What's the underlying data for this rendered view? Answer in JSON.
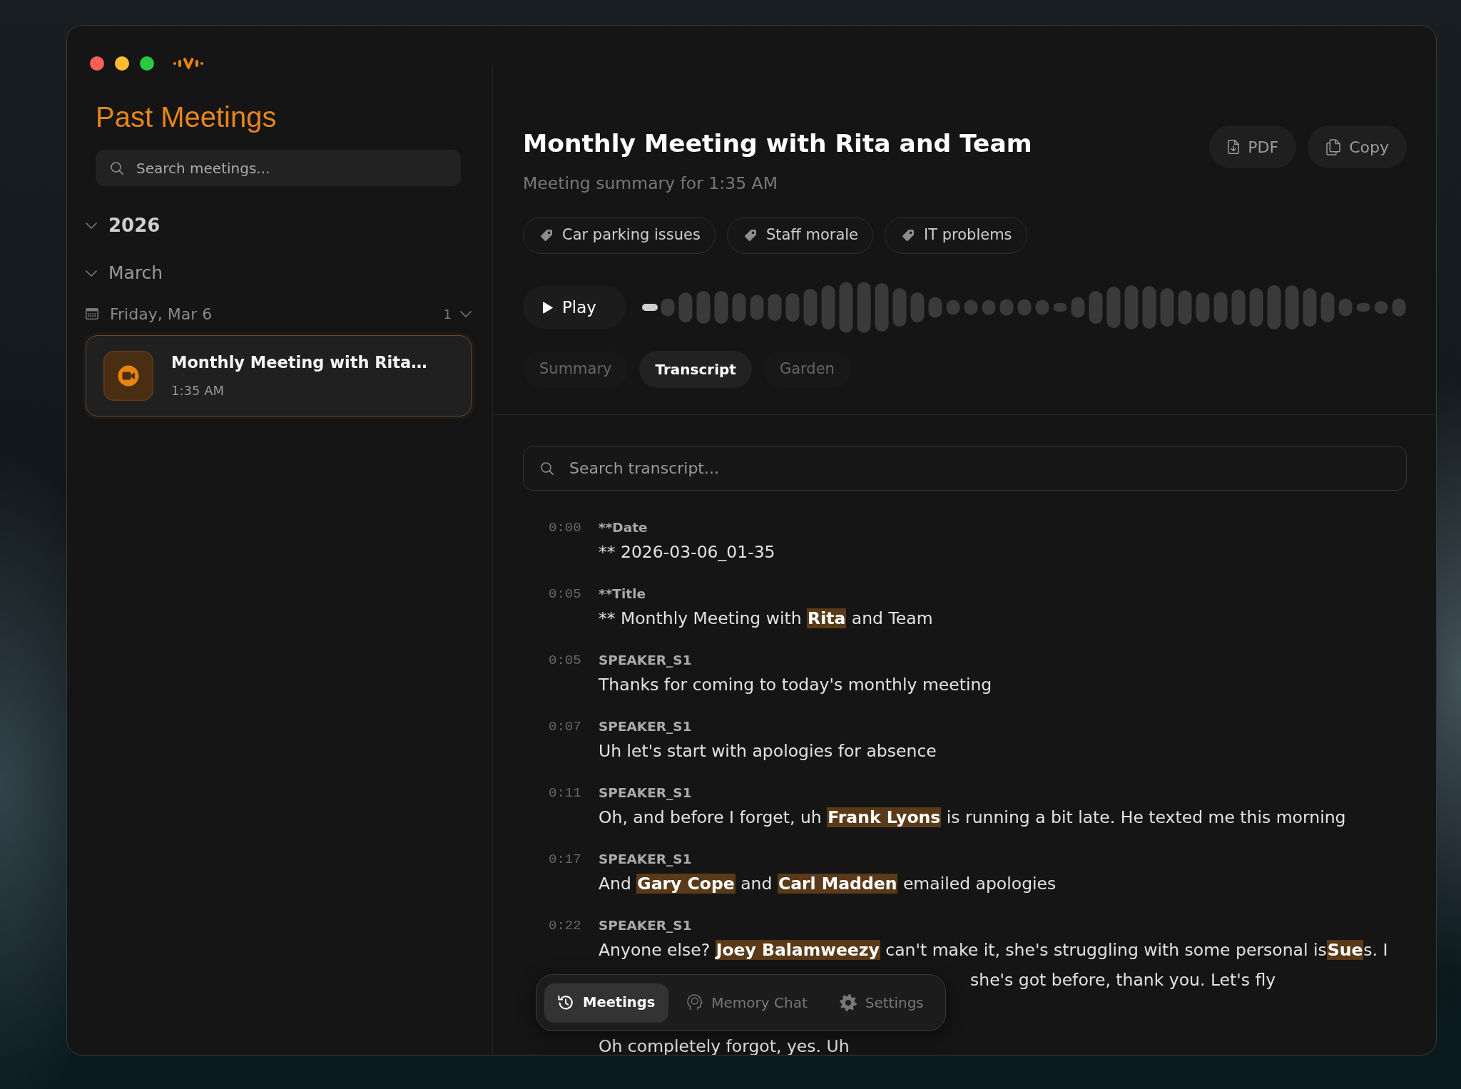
{
  "sidebar": {
    "title": "Past Meetings",
    "search": {
      "placeholder": "Search meetings..."
    },
    "tree": [
      {
        "kind": "year",
        "label": "2026",
        "expanded": true,
        "children": [
          {
            "kind": "month",
            "label": "March",
            "expanded": true,
            "children": [
              {
                "kind": "day",
                "label": "Friday, Mar 6",
                "count": "1",
                "expanded": true,
                "meetings": [
                  {
                    "title": "Monthly Meeting with Rita…",
                    "time": "1:35 AM",
                    "selected": true
                  }
                ]
              }
            ]
          }
        ]
      }
    ]
  },
  "meeting": {
    "title": "Monthly Meeting with Rita and Team",
    "subtitle": "Meeting summary for 1:35 AM",
    "actions": [
      {
        "kind": "pdf",
        "label": "PDF"
      },
      {
        "kind": "copy",
        "label": "Copy"
      }
    ],
    "tags": [
      "Car parking issues",
      "Staff morale",
      "IT problems"
    ],
    "player": {
      "button": "Play"
    },
    "tabs": [
      {
        "label": "Summary",
        "selected": false
      },
      {
        "label": "Transcript",
        "selected": true
      },
      {
        "label": "Garden",
        "selected": false
      }
    ]
  },
  "transcript": {
    "search": {
      "placeholder": "Search transcript..."
    },
    "entries": [
      {
        "time": "0:00",
        "speaker": "**Date",
        "lines": [
          {
            "kind": "full",
            "parts": [
              {
                "text": "** 2026-03-06_01-35",
                "highlighted": false
              }
            ]
          }
        ]
      },
      {
        "time": "0:05",
        "speaker": "**Title",
        "lines": [
          {
            "kind": "full",
            "parts": [
              {
                "text": "** Monthly Meeting with ",
                "highlighted": false
              },
              {
                "text": "Rita",
                "highlighted": true
              },
              {
                "text": " and Team",
                "highlighted": false
              }
            ]
          }
        ]
      },
      {
        "time": "0:05",
        "speaker": "SPEAKER_S1",
        "lines": [
          {
            "kind": "full",
            "parts": [
              {
                "text": "Thanks for coming to today's monthly meeting",
                "highlighted": false
              }
            ]
          }
        ]
      },
      {
        "time": "0:07",
        "speaker": "SPEAKER_S1",
        "lines": [
          {
            "kind": "full",
            "parts": [
              {
                "text": "Uh let's start with apologies for absence",
                "highlighted": false
              }
            ]
          }
        ]
      },
      {
        "time": "0:11",
        "speaker": "SPEAKER_S1",
        "lines": [
          {
            "kind": "full",
            "parts": [
              {
                "text": "Oh, and before I forget, uh ",
                "highlighted": false
              },
              {
                "text": "Frank Lyons",
                "highlighted": true
              },
              {
                "text": " is running a bit late. He texted me this morning",
                "highlighted": false
              }
            ]
          }
        ]
      },
      {
        "time": "0:17",
        "speaker": "SPEAKER_S1",
        "lines": [
          {
            "kind": "full",
            "parts": [
              {
                "text": "And ",
                "highlighted": false
              },
              {
                "text": "Gary Cope",
                "highlighted": true
              },
              {
                "text": " and ",
                "highlighted": false
              },
              {
                "text": "Carl Madden",
                "highlighted": true
              },
              {
                "text": " emailed apologies",
                "highlighted": false
              }
            ]
          }
        ]
      },
      {
        "time": "0:22",
        "speaker": "SPEAKER_S1",
        "lines": [
          {
            "kind": "full",
            "parts": [
              {
                "text": "Anyone else? ",
                "highlighted": false
              },
              {
                "text": "Joey Balamweezy",
                "highlighted": true
              },
              {
                "text": " can't make it, she's struggling with some personal is",
                "highlighted": false
              },
              {
                "text": "Sue",
                "highlighted": true
              },
              {
                "text": "s. I",
                "highlighted": false
              }
            ]
          },
          {
            "kind": "tail",
            "parts": [
              {
                "text": "she's got before, thank you. Let's fly",
                "highlighted": false
              }
            ]
          }
        ]
      },
      {
        "lines": [
          {
            "kind": "full",
            "parts": [
              {
                "text": "Oh completely forgot, yes. Uh",
                "highlighted": false
              }
            ]
          }
        ]
      }
    ]
  },
  "bottom_nav": [
    {
      "kind": "history",
      "label": "Meetings",
      "selected": true
    },
    {
      "kind": "brain",
      "label": "Memory Chat",
      "selected": false
    },
    {
      "kind": "gear",
      "label": "Settings",
      "selected": false
    }
  ]
}
